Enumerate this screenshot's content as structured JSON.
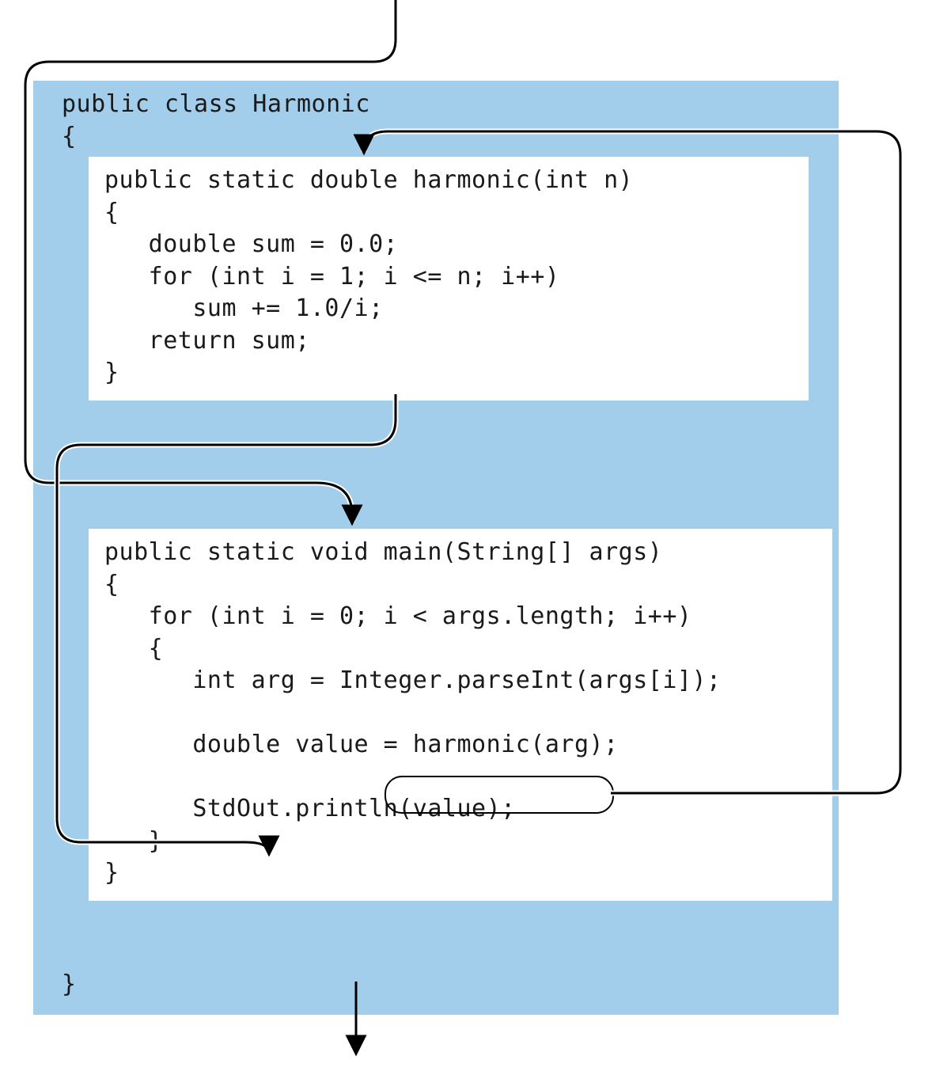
{
  "class": {
    "decl_line1": "public class Harmonic",
    "decl_line2": "{",
    "close": "}"
  },
  "harmonic_method": {
    "code": "public static double harmonic(int n)\n{\n   double sum = 0.0;\n   for (int i = 1; i <= n; i++)\n      sum += 1.0/i;\n   return sum;\n}"
  },
  "main_method": {
    "code": "public static void main(String[] args)\n{\n   for (int i = 0; i < args.length; i++)\n   {\n      int arg = Integer.parseInt(args[i]);\n\n      double value = harmonic(arg);\n\n      StdOut.println(value);\n   }\n}"
  },
  "callout": {
    "text": "harmonic(arg);"
  }
}
